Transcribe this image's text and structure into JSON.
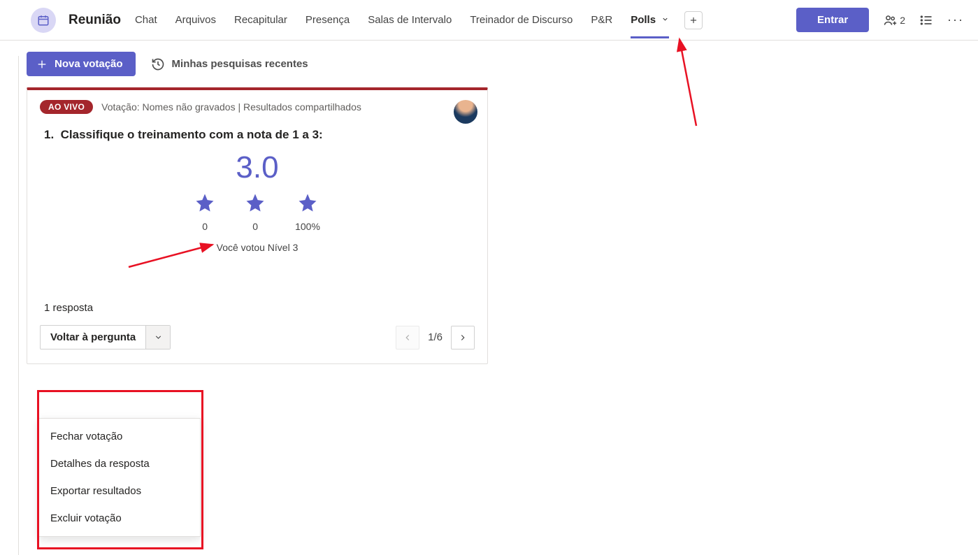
{
  "header": {
    "title": "Reunião",
    "tabs": [
      "Chat",
      "Arquivos",
      "Recapitular",
      "Presença",
      "Salas de Intervalo",
      "Treinador de Discurso",
      "P&R",
      "Polls"
    ],
    "active_tab": "Polls",
    "join_label": "Entrar",
    "people_count": "2"
  },
  "toolbar": {
    "new_poll_label": "Nova votação",
    "recent_label": "Minhas pesquisas recentes"
  },
  "poll": {
    "live_badge": "AO VIVO",
    "meta": "Votação: Nomes não gravados | Resultados compartilhados",
    "question_number": "1.",
    "question": "Classifique o treinamento com a nota de 1 a 3:",
    "score": "3.0",
    "stars": [
      {
        "pct": "0"
      },
      {
        "pct": "0"
      },
      {
        "pct": "100%"
      }
    ],
    "you_voted": "Você votou Nível 3",
    "responses": "1 resposta",
    "back_label": "Voltar à pergunta",
    "pager_text": "1/6"
  },
  "dropdown": {
    "items": [
      "Fechar votação",
      "Detalhes da resposta",
      "Exportar resultados",
      "Excluir votação"
    ]
  }
}
